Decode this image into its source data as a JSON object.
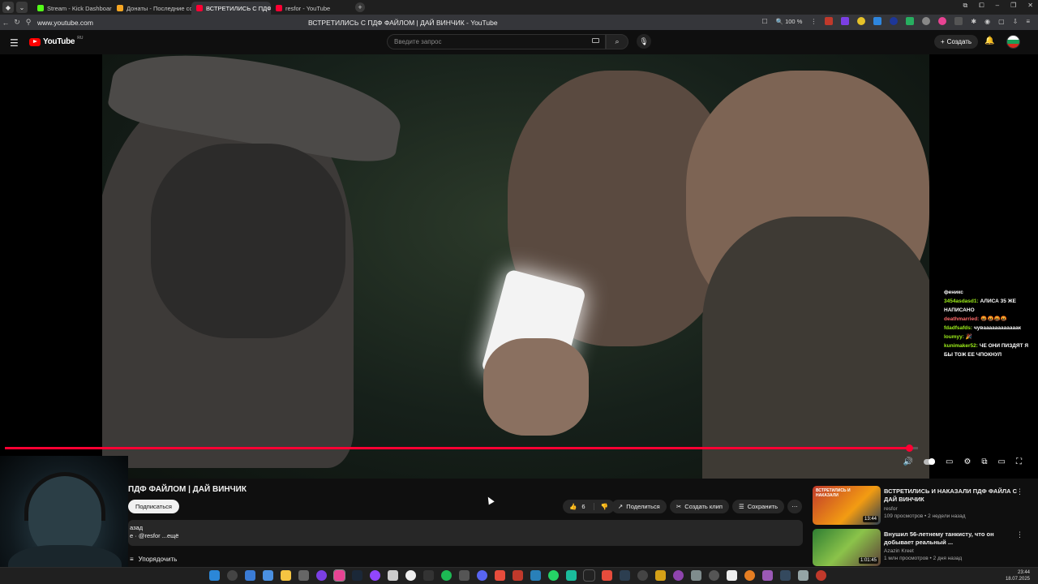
{
  "browser": {
    "tabs": [
      {
        "label": "Stream - Kick Dashboard",
        "color": "#53fc18"
      },
      {
        "label": "Донаты - Последние сооб",
        "color": "#f5a623"
      },
      {
        "label": "ВСТРЕТИЛИСЬ С ПДФ",
        "color": "#ff0033",
        "active": true
      },
      {
        "label": "resfor - YouTube",
        "color": "#ff0033"
      }
    ],
    "new_tab_icon": "plus-icon",
    "url": "www.youtube.com",
    "page_title": "ВСТРЕТИЛИСЬ С ПДФ ФАЙЛОМ | ДАЙ ВИНЧИК - YouTube",
    "zoom": "100 %"
  },
  "youtube": {
    "logo_text": "YouTube",
    "logo_region": "RU",
    "search_placeholder": "Введите запрос",
    "create_label": "Создать"
  },
  "player": {
    "progress": 0.99,
    "accent": "#ff0033"
  },
  "chat": [
    {
      "user": "феникс",
      "color": "#ffffff",
      "msg": ""
    },
    {
      "user": "3454asdasd1:",
      "color": "#9ef01a",
      "msg": "АЛИСА 35 ЖЕ НАПИСАНО"
    },
    {
      "user": "deathmarried:",
      "color": "#ff6b6b",
      "msg": "🤬🤬🤬🤬"
    },
    {
      "user": "fdadfsafds:",
      "color": "#9ef01a",
      "msg": "чуваааааааааааак"
    },
    {
      "user": "loumyy:",
      "color": "#9ef01a",
      "msg": "🎉"
    },
    {
      "user": "kunimaker52:",
      "color": "#9ef01a",
      "msg": "ЧЕ ОНИ ПИЗДЯТ Я БЫ ТОЖ ЕЕ ЧПОКНУЛ"
    }
  ],
  "video": {
    "title": "ПДФ ФАЙЛОМ | ДАЙ ВИНЧИК",
    "subscribe_label": "Подписаться",
    "likes": "6",
    "share_label": "Поделиться",
    "clip_label": "Создать клип",
    "save_label": "Сохранить",
    "desc_line1": "азад",
    "desc_line2": "е · @resfor ...ещё",
    "sort_label": "Упорядочить"
  },
  "recommendations": [
    {
      "title": "ВСТРЕТИЛИСЬ И НАКАЗАЛИ ПДФ ФАЙЛА С ДАЙ ВИНЧИК",
      "channel": "resfor",
      "meta": "109 просмотров • 2 недели назад",
      "duration": "13:44",
      "thumb_text": "ВСТРЕТИЛИСЬ И НАКАЗАЛИ"
    },
    {
      "title": "Внушил 56-летнему танкисту, что он добывает реальный ...",
      "channel": "Azazin Kreet",
      "meta": "1 млн просмотров • 2 дня назад",
      "duration": "1:01:45",
      "thumb_text": ""
    }
  ],
  "clock": {
    "time": "23:44",
    "date": "18.07.2025"
  }
}
